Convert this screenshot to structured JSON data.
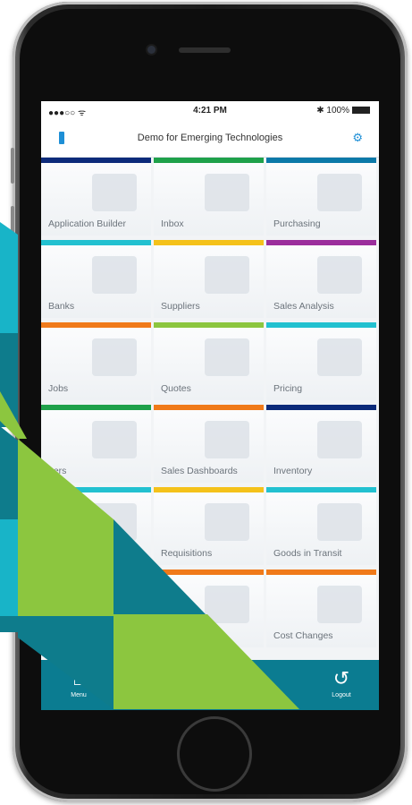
{
  "status_bar": {
    "signal": "●●●○○ ᯤ",
    "time": "4:21 PM",
    "battery": "✱ 100%"
  },
  "header": {
    "title": "Demo for Emerging Technologies"
  },
  "tiles": [
    {
      "label": "Application Builder",
      "color": "#0d2b7a"
    },
    {
      "label": "Inbox",
      "color": "#1fa14a"
    },
    {
      "label": "Purchasing",
      "color": "#0b79a8"
    },
    {
      "label": "Banks",
      "color": "#22c1d0"
    },
    {
      "label": "Suppliers",
      "color": "#f4c21a"
    },
    {
      "label": "Sales Analysis",
      "color": "#9b2e9c"
    },
    {
      "label": "Jobs",
      "color": "#f07a1a"
    },
    {
      "label": "Quotes",
      "color": "#8cc63f"
    },
    {
      "label": "Pricing",
      "color": "#22c1d0"
    },
    {
      "label": "pers",
      "color": "#1fa14a"
    },
    {
      "label": "Sales Dashboards",
      "color": "#f07a1a"
    },
    {
      "label": "Inventory",
      "color": "#0d2b7a"
    },
    {
      "label": "",
      "color": "#22c1d0"
    },
    {
      "label": "Requisitions",
      "color": "#f4c21a"
    },
    {
      "label": "Goods in Transit",
      "color": "#22c1d0"
    },
    {
      "label": "",
      "color": "#f07a1a"
    },
    {
      "label": "",
      "color": "#f07a1a"
    },
    {
      "label": "Cost Changes",
      "color": "#f07a1a"
    }
  ],
  "tabbar": {
    "menu_label": "Menu",
    "logout_label": "Logout"
  },
  "colors": {
    "tabbar": "#0b7c91",
    "accent": "#1e8fd6",
    "shape_teal": "#0e7c8c",
    "shape_cyan": "#18b4c8",
    "shape_green": "#8cc63f"
  }
}
